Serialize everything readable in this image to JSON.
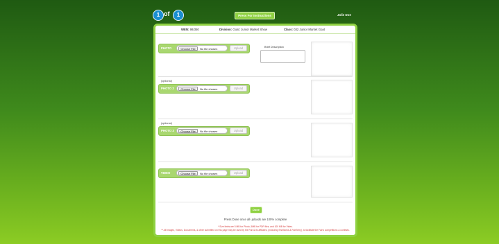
{
  "header": {
    "current_step": "1",
    "of_label": "of",
    "total_steps": "1",
    "instructions_button": "Press For Instructions",
    "user_name": "Jolie Doe"
  },
  "entry_info": {
    "wen_label": "WEN:",
    "wen_value": "98/350",
    "division_label": "Division:",
    "division_value": "Goat: Junior Market Show",
    "class_label": "Class:",
    "class_value": "032 Junior Market Goat"
  },
  "description": {
    "label": "Brief Description",
    "value": ""
  },
  "uploads": [
    {
      "label": "PHOTO",
      "optional_text": "",
      "choose_label": "Choose File",
      "file_status": "No file chosen",
      "upload_label": "Upload"
    },
    {
      "label": "PHOTO 2",
      "optional_text": "(optional)",
      "choose_label": "Choose File",
      "file_status": "No file chosen",
      "upload_label": "Upload"
    },
    {
      "label": "PHOTO 3",
      "optional_text": "(optional)",
      "choose_label": "Choose File",
      "file_status": "No file chosen",
      "upload_label": "Upload"
    },
    {
      "label": "VIDEO",
      "optional_text": "",
      "choose_label": "Choose File",
      "file_status": "No file chosen",
      "upload_label": "Upload"
    }
  ],
  "footer": {
    "done_button": "Done",
    "done_note": "Press Done once all uploads are 100% complete",
    "size_limits": "* Size limits are 5 MB for Photo, 5MB for PDF files, and 100 MB for Video.",
    "disclaimer": "** All Images, Videos, Documents, & other submitted on this page may be used by the Fair & its affiliates, (including ShoWorks & FairEntry), to facilitate the Fair's competitions & contests."
  },
  "colors": {
    "accent_green": "#8fd142",
    "step_blue": "#1a8fd0",
    "warning_red": "#d43a3a"
  }
}
